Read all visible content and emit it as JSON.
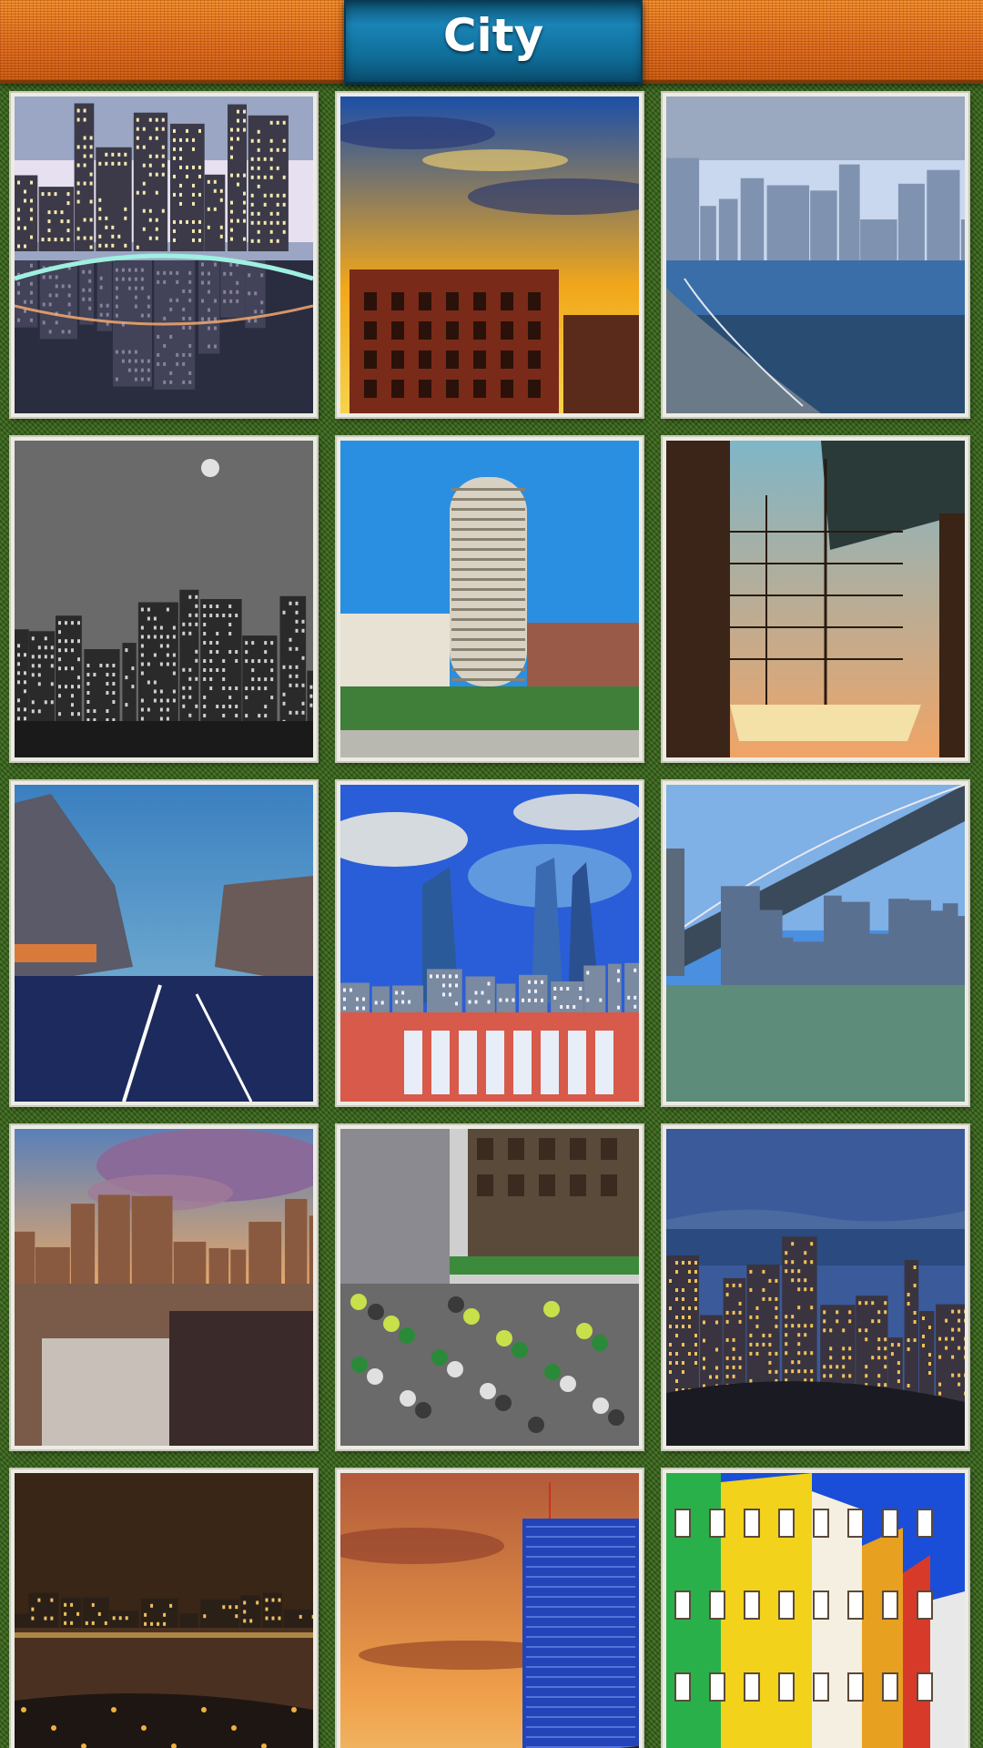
{
  "header": {
    "title": "City"
  },
  "gallery": {
    "items": [
      {
        "id": "city-1",
        "scene": "night-bridge-reflection",
        "colors": [
          "#9aa6c4",
          "#e6e0f0",
          "#2a2c40"
        ]
      },
      {
        "id": "city-2",
        "scene": "sunset-sky-building",
        "colors": [
          "#1c4fa8",
          "#f2a71a",
          "#7a2a18"
        ]
      },
      {
        "id": "city-3",
        "scene": "waterfront-skyline",
        "colors": [
          "#c9d7ef",
          "#3a6ea8",
          "#1e3550"
        ]
      },
      {
        "id": "city-4",
        "scene": "monochrome-skyscrapers",
        "colors": [
          "#6a6a6a",
          "#cfcfcf",
          "#1a1a1a"
        ]
      },
      {
        "id": "city-5",
        "scene": "round-tower-blue-sky",
        "colors": [
          "#2a8fe0",
          "#d8d2c4",
          "#3f7f3a"
        ]
      },
      {
        "id": "city-6",
        "scene": "tall-ship-dusk",
        "colors": [
          "#7fb6c8",
          "#f0a466",
          "#3b2418"
        ]
      },
      {
        "id": "city-7",
        "scene": "street-evening",
        "colors": [
          "#3a7fc0",
          "#1c2a5e",
          "#d87a3a"
        ]
      },
      {
        "id": "city-8",
        "scene": "hdr-towers-clouds",
        "colors": [
          "#2a5ed8",
          "#f3f0e0",
          "#6fa8e0"
        ]
      },
      {
        "id": "city-9",
        "scene": "bridge-bay-skyline",
        "colors": [
          "#4a8fe0",
          "#cfe0f0",
          "#5d8c7a"
        ]
      },
      {
        "id": "city-10",
        "scene": "rooftops-storm-clouds",
        "colors": [
          "#8a6a98",
          "#e8a868",
          "#3a2a2a"
        ]
      },
      {
        "id": "city-11",
        "scene": "street-cyclists",
        "colors": [
          "#cfcfcf",
          "#5a4a3a",
          "#3c8a3c"
        ]
      },
      {
        "id": "city-12",
        "scene": "night-harbour-view",
        "colors": [
          "#3a5a9a",
          "#f2c25a",
          "#1a1a22"
        ]
      },
      {
        "id": "city-13",
        "scene": "night-river-skyline",
        "colors": [
          "#3a2616",
          "#f0c060",
          "#1e1612"
        ]
      },
      {
        "id": "city-14",
        "scene": "orange-sky-glass-tower",
        "colors": [
          "#b25a3a",
          "#2244b8",
          "#f0a04a"
        ]
      },
      {
        "id": "city-15",
        "scene": "colorful-facades",
        "colors": [
          "#1a4ed8",
          "#f2d21a",
          "#2ab04a"
        ]
      }
    ]
  }
}
